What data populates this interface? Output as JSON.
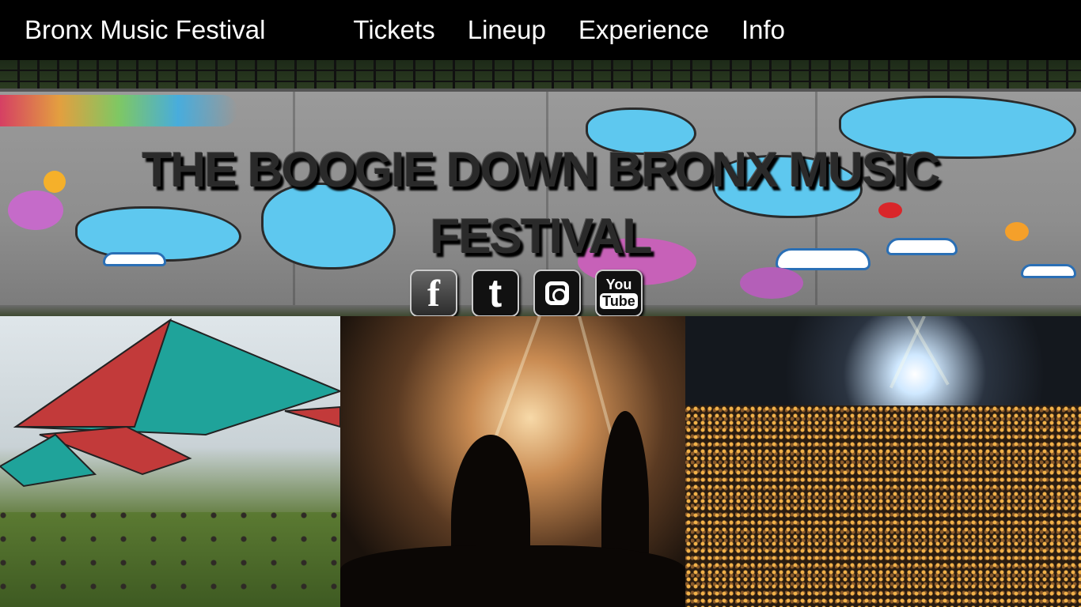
{
  "nav": {
    "brand": "Bronx Music Festival",
    "links": [
      "Tickets",
      "Lineup",
      "Experience",
      "Info"
    ]
  },
  "hero": {
    "title": "THE BOOGIE DOWN BRONX MUSIC FESTIVAL",
    "socials": [
      {
        "name": "facebook-icon",
        "glyph": "f"
      },
      {
        "name": "twitter-icon",
        "glyph": "t"
      },
      {
        "name": "instagram-icon",
        "glyph": ""
      },
      {
        "name": "youtube-icon",
        "glyph_top": "You",
        "glyph_bottom": "Tube"
      }
    ]
  },
  "colors": {
    "nav_bg": "#000000",
    "nav_text": "#ffffff",
    "title_text": "#2a2a2a"
  }
}
